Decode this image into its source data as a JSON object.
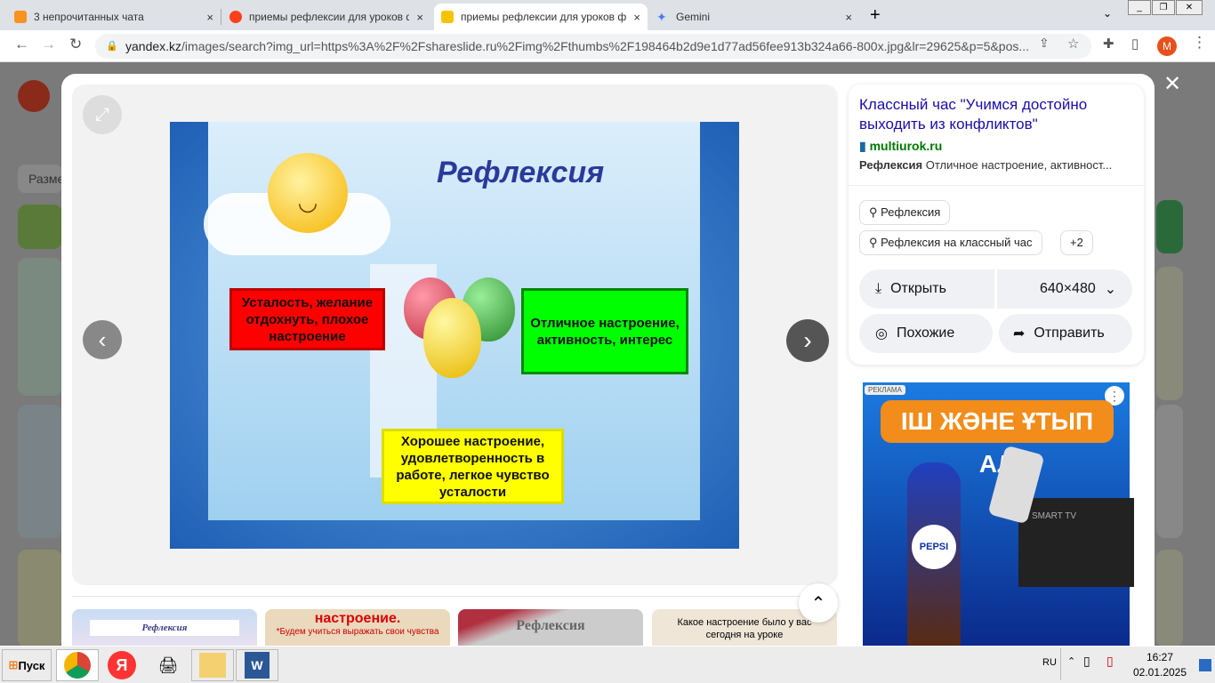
{
  "tabs": [
    {
      "label": "3 непрочитанных чата",
      "color": "#f7931e",
      "close": "×"
    },
    {
      "label": "приемы рефлексии для уроков фи",
      "color": "#fc3f1d",
      "close": "×"
    },
    {
      "label": "приемы рефлексии для уроков фи",
      "color": "#f5c400",
      "close": "×",
      "active": true
    },
    {
      "label": "Gemini",
      "color": "#4a7cf0",
      "close": "×"
    }
  ],
  "new_tab": "+",
  "address": {
    "domain": "yandex.kz",
    "path": "/images/search?img_url=https%3A%2F%2Fshareslide.ru%2Fimg%2Fthumbs%2F198464b2d9e1d77ad56fee913b324a66-800x.jpg&lr=29625&p=5&pos..."
  },
  "profile_initial": "М",
  "background_page": {
    "size_label": "Разме"
  },
  "slide": {
    "title": "Рефлексия",
    "red_box": "Усталость, желание отдохнуть, плохое настроение",
    "green_box": "Отличное настроение, активность, интерес",
    "yellow_box": "Хорошее настроение, удовлетворенность в работе, легкое чувство усталости"
  },
  "info": {
    "title": "Классный час \"Учимся достойно выходить из конфликтов\"",
    "source": "multiurok.ru",
    "desc_bold": "Рефлексия",
    "desc": " Отличное настроение, активност...",
    "tags": [
      "Рефлексия",
      "Рефлексия на классный час"
    ],
    "more_tags": "+2",
    "open": "Открыть",
    "size": "640×480",
    "similar": "Похожие",
    "share": "Отправить"
  },
  "ad": {
    "label": "РЕКЛАМА",
    "headline": "ІШ ЖӘНЕ ҰТЫП АЛ",
    "brand": "PEPSI",
    "tv": "SMART TV"
  },
  "thumbs": [
    "Рефлексия",
    "настроение.",
    "*Будем учиться выражать свои чувства",
    "Рефлексия",
    "Какое настроение было у вас сегодня на уроке"
  ],
  "taskbar": {
    "start": "Пуск",
    "lang": "RU",
    "time": "16:27",
    "date": "02.01.2025"
  }
}
